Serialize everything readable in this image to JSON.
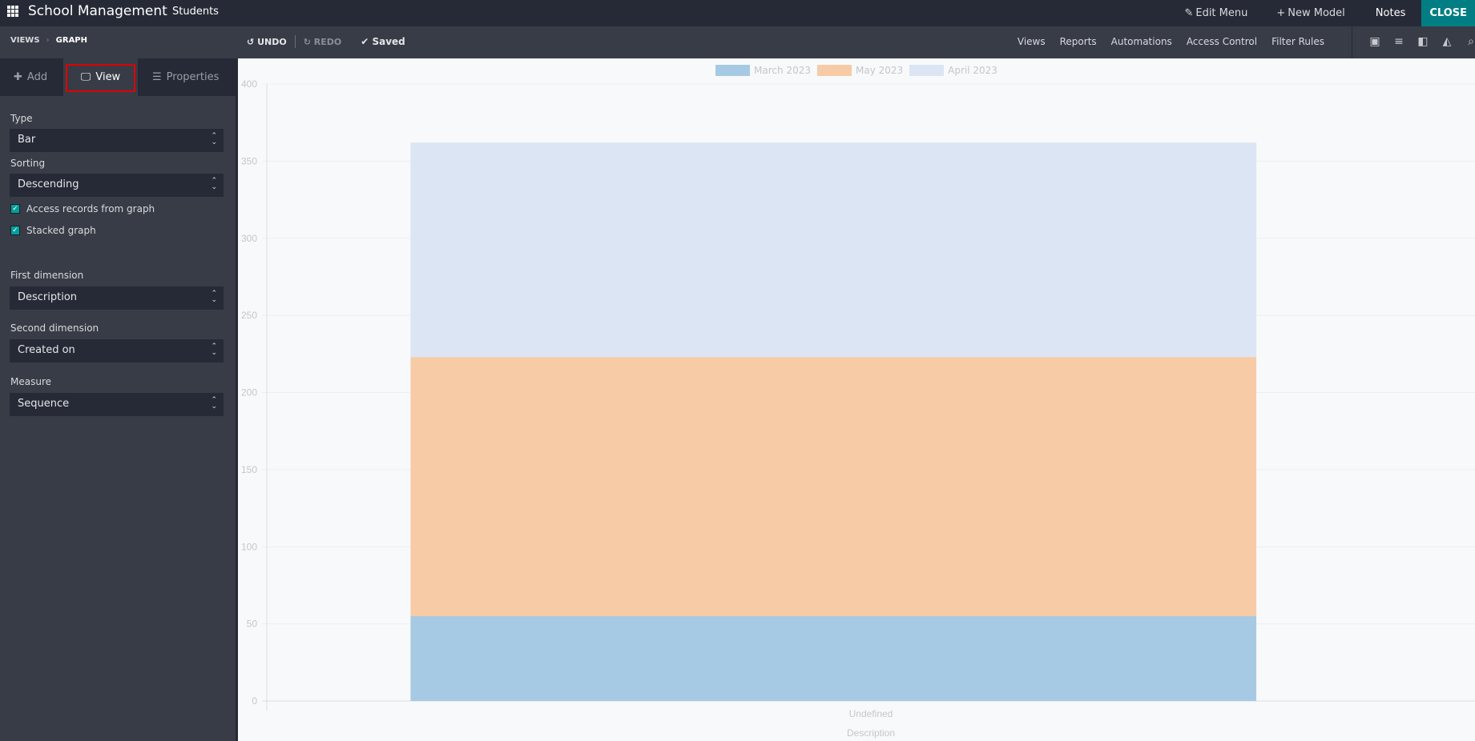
{
  "topbar": {
    "app_title": "School Management",
    "menu_item": "Students",
    "edit_menu": "Edit Menu",
    "new_model": "New Model",
    "notes": "Notes",
    "close": "CLOSE"
  },
  "subbar": {
    "breadcrumb": [
      "VIEWS",
      "GRAPH"
    ],
    "undo": "UNDO",
    "redo": "REDO",
    "saved": "Saved",
    "links": [
      "Views",
      "Reports",
      "Automations",
      "Access Control",
      "Filter Rules"
    ],
    "view_icons": [
      "form-view-icon",
      "list-view-icon",
      "kanban-view-icon",
      "graph-view-icon",
      "search-view-icon"
    ]
  },
  "sidebar": {
    "tabs": {
      "add": "Add",
      "view": "View",
      "properties": "Properties"
    },
    "type": {
      "label": "Type",
      "value": "Bar"
    },
    "sorting": {
      "label": "Sorting",
      "value": "Descending"
    },
    "access_records": {
      "label": "Access records from graph",
      "checked": true
    },
    "stacked": {
      "label": "Stacked graph",
      "checked": true
    },
    "first_dimension": {
      "label": "First dimension",
      "value": "Description"
    },
    "second_dimension": {
      "label": "Second dimension",
      "value": "Created on"
    },
    "measure": {
      "label": "Measure",
      "value": "Sequence"
    }
  },
  "chart_data": {
    "type": "bar",
    "stacked": true,
    "categories": [
      "Undefined"
    ],
    "series": [
      {
        "name": "March 2023",
        "values": [
          55
        ],
        "color": "#a6cae3"
      },
      {
        "name": "May 2023",
        "values": [
          168
        ],
        "color": "#f7cba6"
      },
      {
        "name": "April 2023",
        "values": [
          139
        ],
        "color": "#dce5f4"
      }
    ],
    "xlabel": "Description",
    "ylabel": "",
    "ylim": [
      0,
      400
    ],
    "yticks": [
      0,
      50,
      100,
      150,
      200,
      250,
      300,
      350,
      400
    ],
    "grid": true,
    "legend": "top-center"
  }
}
